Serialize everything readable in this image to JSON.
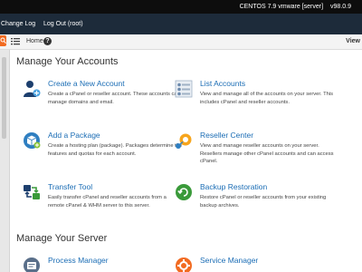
{
  "topbar": {
    "system": "CENTOS 7.9 vmware [server]",
    "version": "v98.0.9"
  },
  "nav": {
    "change_log": "Change Log",
    "log_out": "Log Out (root)"
  },
  "breadcrumb": {
    "home": "Home",
    "view": "View"
  },
  "sections": [
    {
      "title": "Manage Your Accounts",
      "items": [
        {
          "title": "Create a New Account",
          "icon": "add-user-icon",
          "description": "Create a cPanel or reseller account. These accounts can manage domains and email."
        },
        {
          "title": "List Accounts",
          "icon": "list-accounts-icon",
          "description": "View and manage all of the accounts on your server. This includes cPanel and reseller accounts."
        },
        {
          "title": "Add a Package",
          "icon": "package-icon",
          "description": "Create a hosting plan (package). Packages determine the features and quotas for each account."
        },
        {
          "title": "Reseller Center",
          "icon": "reseller-icon",
          "description": "View and manage reseller accounts on your server. Resellers manage other cPanel accounts and can access cPanel."
        },
        {
          "title": "Transfer Tool",
          "icon": "transfer-icon",
          "description": "Easily transfer cPanel and reseller accounts from a remote cPanel & WHM server to this server."
        },
        {
          "title": "Backup Restoration",
          "icon": "backup-icon",
          "description": "Restore cPanel or reseller accounts from your existing backup archives."
        }
      ]
    },
    {
      "title": "Manage Your Server",
      "items": [
        {
          "title": "Process Manager",
          "icon": "process-manager-icon"
        },
        {
          "title": "Service Manager",
          "icon": "service-manager-icon"
        }
      ]
    }
  ],
  "colors": {
    "topbar": "#0d0d0d",
    "navbar": "#1d2b3a",
    "link": "#1b6db5",
    "accent_orange": "#f26b21"
  }
}
